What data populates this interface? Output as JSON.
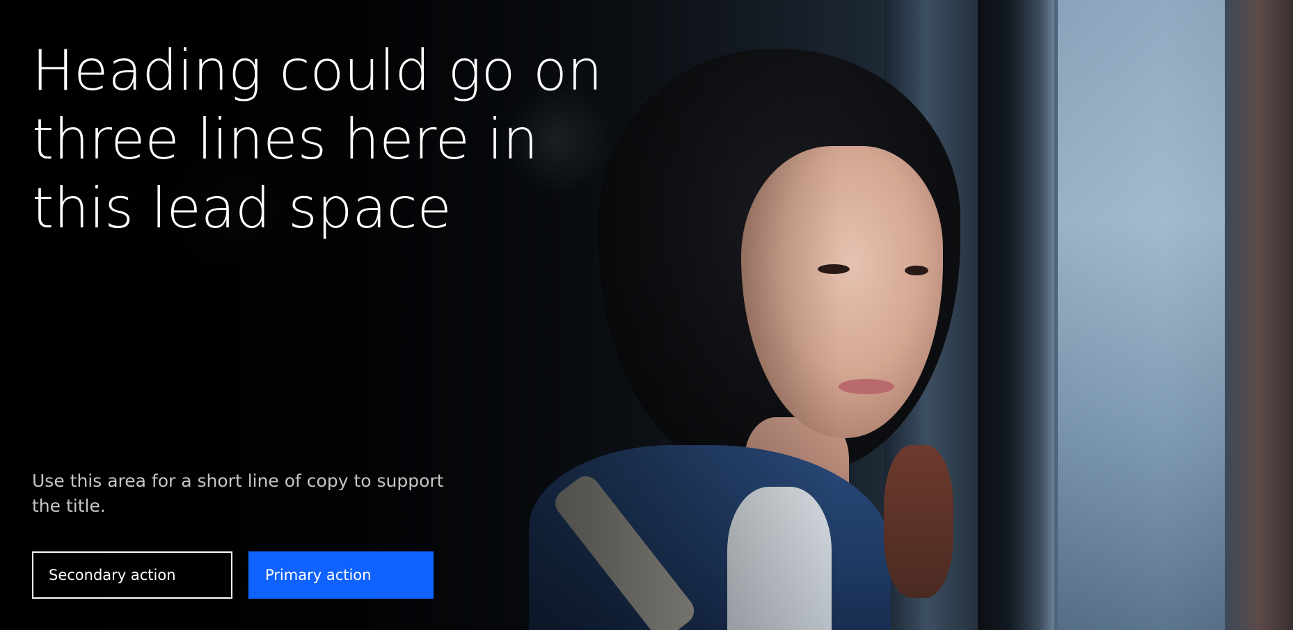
{
  "leadspace": {
    "heading": "Heading could go on three lines here in this lead space",
    "copy": "Use this area for a short line of copy to support the title.",
    "secondary_action_label": "Secondary action",
    "primary_action_label": "Primary action"
  },
  "colors": {
    "primary_button": "#0f62fe",
    "heading_text": "#ffffff",
    "copy_text": "#c6c6c6",
    "secondary_button_border": "#ffffff"
  }
}
